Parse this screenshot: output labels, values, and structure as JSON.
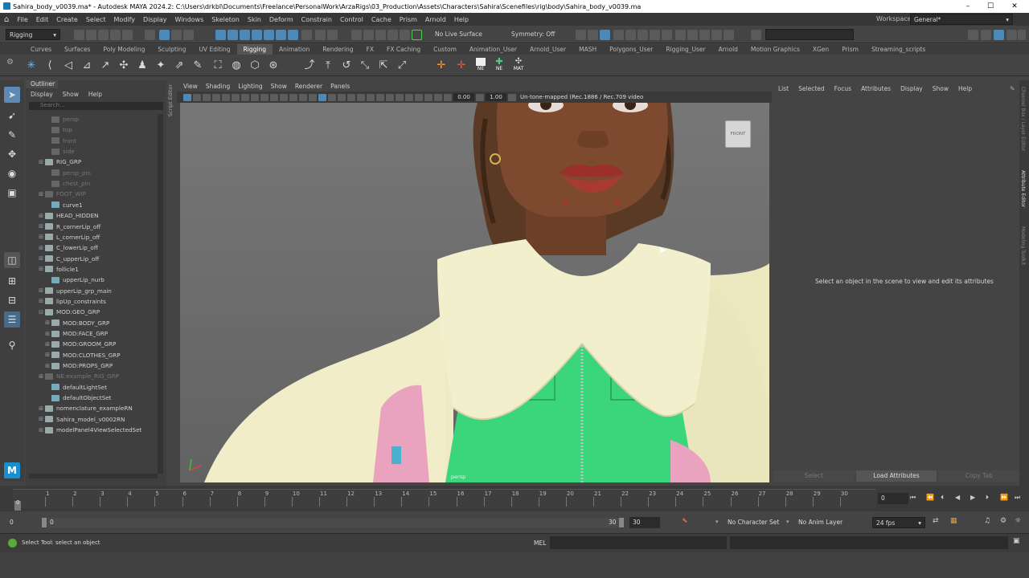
{
  "window": {
    "title": "Sahira_body_v0039.ma* - Autodesk MAYA 2024.2: C:\\Users\\drkbl\\Documents\\Freelance\\PersonalWork\\ArzaRigs\\03_Production\\Assets\\Characters\\Sahira\\Scenefiles\\rig\\body\\Sahira_body_v0039.ma",
    "minimize": "–",
    "maximize": "☐",
    "close": "✕"
  },
  "menubar": [
    "File",
    "Edit",
    "Create",
    "Select",
    "Modify",
    "Display",
    "Windows",
    "Skeleton",
    "Skin",
    "Deform",
    "Constrain",
    "Control",
    "Cache",
    "Prism",
    "Arnold",
    "Help"
  ],
  "workspace": {
    "label": "Workspace:",
    "value": "General*"
  },
  "statusline": {
    "menuset": "Rigging",
    "live_surface": "No Live Surface",
    "symmetry": "Symmetry: Off"
  },
  "shelf_tabs": [
    "Curves",
    "Surfaces",
    "Poly Modeling",
    "Sculpting",
    "UV Editing",
    "Rigging",
    "Animation",
    "Rendering",
    "FX",
    "FX Caching",
    "Custom",
    "Animation_User",
    "Arnold_User",
    "MASH",
    "Polygons_User",
    "Rigging_User",
    "Arnold",
    "Motion Graphics",
    "XGen",
    "Prism",
    "Streaming_scripts"
  ],
  "shelf_active": "Rigging",
  "shelf_labels": {
    "ne1": "NE",
    "ne2": "NE",
    "mat": "MAT"
  },
  "outliner": {
    "title": "Outliner",
    "menu": [
      "Display",
      "Show",
      "Help"
    ],
    "search_placeholder": "Search...",
    "items": [
      {
        "label": "persp",
        "indent": 1,
        "dim": true,
        "expand": ""
      },
      {
        "label": "top",
        "indent": 1,
        "dim": true,
        "expand": ""
      },
      {
        "label": "front",
        "indent": 1,
        "dim": true,
        "expand": ""
      },
      {
        "label": "side",
        "indent": 1,
        "dim": true,
        "expand": ""
      },
      {
        "label": "RIG_GRP",
        "indent": 0,
        "dim": false,
        "expand": "⊞"
      },
      {
        "label": "persp_pin",
        "indent": 1,
        "dim": true,
        "expand": ""
      },
      {
        "label": "chest_pin",
        "indent": 1,
        "dim": true,
        "expand": ""
      },
      {
        "label": "FOOT_WIP",
        "indent": 0,
        "dim": true,
        "expand": "⊞"
      },
      {
        "label": "curve1",
        "indent": 1,
        "dim": false,
        "expand": ""
      },
      {
        "label": "HEAD_HIDDEN",
        "indent": 0,
        "dim": false,
        "expand": "⊞"
      },
      {
        "label": "R_cornerLip_off",
        "indent": 0,
        "dim": false,
        "expand": "⊞"
      },
      {
        "label": "L_cornerLip_off",
        "indent": 0,
        "dim": false,
        "expand": "⊞"
      },
      {
        "label": "C_lowerLip_off",
        "indent": 0,
        "dim": false,
        "expand": "⊞"
      },
      {
        "label": "C_upperLip_off",
        "indent": 0,
        "dim": false,
        "expand": "⊞"
      },
      {
        "label": "follicle1",
        "indent": 0,
        "dim": false,
        "expand": "⊞"
      },
      {
        "label": "upperLip_nurb",
        "indent": 1,
        "dim": false,
        "expand": ""
      },
      {
        "label": "upperLip_grp_main",
        "indent": 0,
        "dim": false,
        "expand": "⊞"
      },
      {
        "label": "lipUp_constraints",
        "indent": 0,
        "dim": false,
        "expand": "⊞"
      },
      {
        "label": "MOD:GEO_GRP",
        "indent": 0,
        "dim": false,
        "expand": "⊟"
      },
      {
        "label": "MOD:BODY_GRP",
        "indent": 1,
        "dim": false,
        "expand": "⊞"
      },
      {
        "label": "MOD:FACE_GRP",
        "indent": 1,
        "dim": false,
        "expand": "⊞"
      },
      {
        "label": "MOD:GROOM_GRP",
        "indent": 1,
        "dim": false,
        "expand": "⊞"
      },
      {
        "label": "MOD:CLOTHES_GRP",
        "indent": 1,
        "dim": false,
        "expand": "⊞"
      },
      {
        "label": "MOD:PROPS_GRP",
        "indent": 1,
        "dim": false,
        "expand": "⊞"
      },
      {
        "label": "NE:example_RIG_GRP",
        "indent": 0,
        "dim": true,
        "expand": "⊞"
      },
      {
        "label": "defaultLightSet",
        "indent": 1,
        "dim": false,
        "expand": ""
      },
      {
        "label": "defaultObjectSet",
        "indent": 1,
        "dim": false,
        "expand": ""
      },
      {
        "label": "nomenclature_exampleRN",
        "indent": 0,
        "dim": false,
        "expand": "⊞"
      },
      {
        "label": "Sahira_model_v0002RN",
        "indent": 0,
        "dim": false,
        "expand": "⊞"
      },
      {
        "label": "modelPanel4ViewSelectedSet",
        "indent": 0,
        "dim": false,
        "expand": "⊞"
      }
    ]
  },
  "viewport": {
    "menu": [
      "View",
      "Shading",
      "Lighting",
      "Show",
      "Renderer",
      "Panels"
    ],
    "field1": "0.00",
    "field2": "1.00",
    "colorspace": "Un-tone-mapped (Rec.1886 / Rec.709 video",
    "camera_label": "persp",
    "viewcube": "FRONT"
  },
  "side_tabs": [
    "Script Editor"
  ],
  "attribute_panel": {
    "menu": [
      "List",
      "Selected",
      "Focus",
      "Attributes",
      "Display",
      "Show",
      "Help"
    ],
    "message": "Select an object in the scene to view and edit its attributes",
    "buttons": [
      "Select",
      "Load Attributes",
      "Copy Tab"
    ]
  },
  "right_tabs": [
    "Channel Box / Layer Editor",
    "Attribute Editor",
    "Modeling Toolkit"
  ],
  "timeline": {
    "ticks": [
      "1",
      "2",
      "3",
      "4",
      "5",
      "6",
      "7",
      "8",
      "9",
      "10",
      "11",
      "12",
      "13",
      "14",
      "15",
      "16",
      "17",
      "18",
      "19",
      "20",
      "21",
      "22",
      "23",
      "24",
      "25",
      "26",
      "27",
      "28",
      "29",
      "30"
    ],
    "start_frame": "0",
    "current_frame_field": "0"
  },
  "range": {
    "start": "0",
    "inner_start": "0",
    "inner_end": "30",
    "end": "30",
    "character_set": "No Character Set",
    "anim_layer": "No Anim Layer",
    "fps": "24 fps"
  },
  "commandline": {
    "lang": "MEL"
  },
  "helpline": "Select Tool: select an object"
}
